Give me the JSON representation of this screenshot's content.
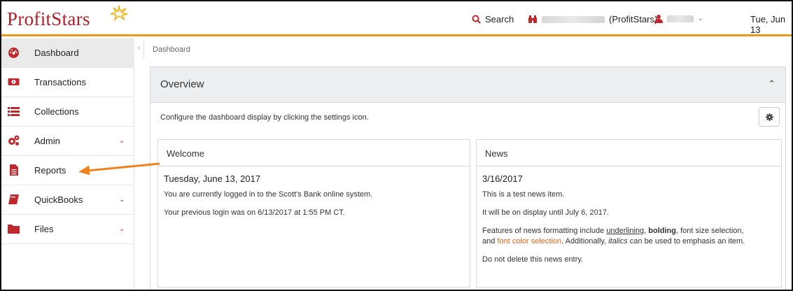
{
  "header": {
    "logo_text": "ProfitStars",
    "search_label": "Search",
    "org_label": "(ProfitStars)",
    "date_label": "Tue, Jun 13",
    "accent_color": "#f0961e",
    "brand_color": "#c0282d"
  },
  "sidebar": {
    "items": [
      {
        "label": "Dashboard",
        "icon": "dashboard-icon"
      },
      {
        "label": "Transactions",
        "icon": "money-icon"
      },
      {
        "label": "Collections",
        "icon": "list-icon"
      },
      {
        "label": "Admin",
        "icon": "gears-icon"
      },
      {
        "label": "Reports",
        "icon": "document-icon"
      },
      {
        "label": "QuickBooks",
        "icon": "book-icon"
      },
      {
        "label": "Files",
        "icon": "folder-icon"
      }
    ]
  },
  "breadcrumb": "Dashboard",
  "overview": {
    "title": "Overview",
    "description": "Configure the dashboard display by clicking the settings icon."
  },
  "welcome": {
    "title": "Welcome",
    "date": "Tuesday, June 13, 2017",
    "line1": "You are currently logged in to the Scott's Bank online system.",
    "line2": "Your previous login was on 6/13/2017 at 1:55 PM CT."
  },
  "news": {
    "title": "News",
    "date": "3/16/2017",
    "line1": "This is a test news item.",
    "line2": "It will be on display until July 6, 2017.",
    "line3_a": "Features of news formatting include ",
    "line3_underline": "underlining",
    "line3_b": ", ",
    "line3_bold": "bolding",
    "line3_c": ", font size selection,",
    "line3_d": "and ",
    "line3_orange": "font color selection",
    "line3_e": ".  Additionally, ",
    "line3_italic": "italics",
    "line3_f": " can be used to emphasis an item.",
    "line4": "Do not delete this news entry."
  }
}
